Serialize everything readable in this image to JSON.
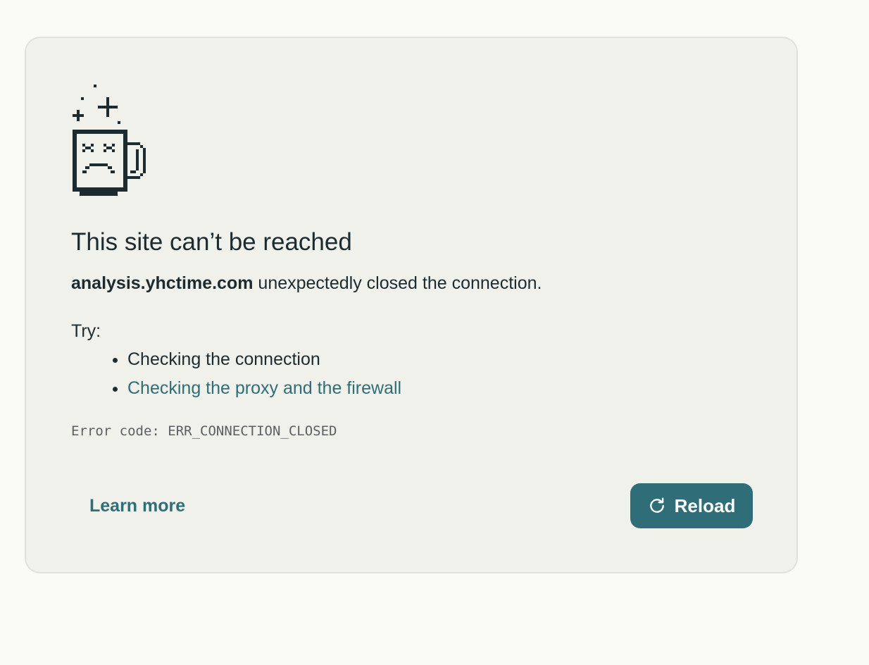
{
  "error_page": {
    "title": "This site can’t be reached",
    "host": "analysis.yhctime.com",
    "message_rest": " unexpectedly closed the connection.",
    "try_label": "Try:",
    "suggestions": [
      "Checking the connection",
      "Checking the proxy and the firewall"
    ],
    "error_code": "Error code: ERR_CONNECTION_CLOSED",
    "learn_more_label": "Learn more",
    "reload_label": "Reload"
  },
  "icons": {
    "illustration": "broken-coffee-mug-icon",
    "reload": "refresh-icon"
  },
  "colors": {
    "accent": "#2f6e78",
    "text": "#1c2b30",
    "card_bg": "#f1f1ec",
    "page_bg": "#fbfbf6"
  }
}
